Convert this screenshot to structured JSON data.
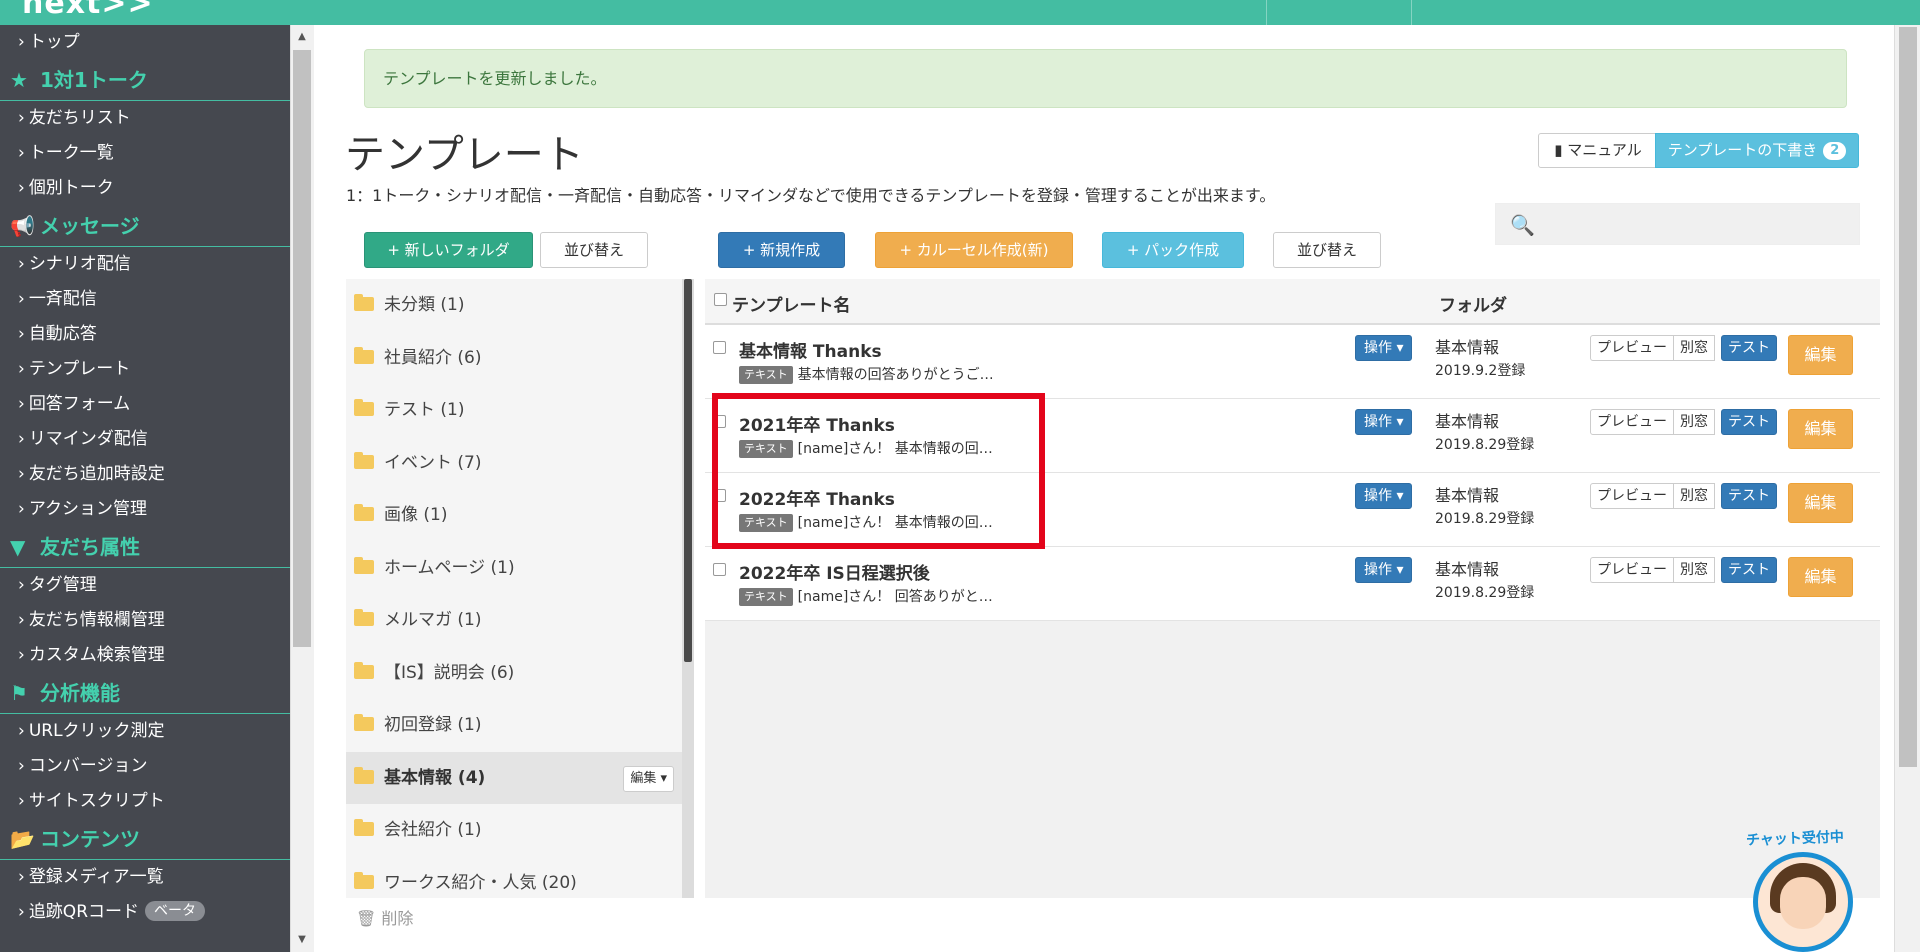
{
  "brand": {
    "logo": "next>>"
  },
  "sidebar": {
    "sections": [
      {
        "type": "item",
        "label": "トップ"
      },
      {
        "type": "section",
        "icon": "star-icon",
        "glyph": "★",
        "label": "1対1トーク"
      },
      {
        "type": "item",
        "label": "友だちリスト"
      },
      {
        "type": "item",
        "label": "トーク一覧"
      },
      {
        "type": "item",
        "label": "個別トーク"
      },
      {
        "type": "section",
        "icon": "megaphone-icon",
        "glyph": "📢",
        "label": "メッセージ"
      },
      {
        "type": "item",
        "label": "シナリオ配信"
      },
      {
        "type": "item",
        "label": "一斉配信"
      },
      {
        "type": "item",
        "label": "自動応答"
      },
      {
        "type": "item",
        "label": "テンプレート"
      },
      {
        "type": "item",
        "label": "回答フォーム"
      },
      {
        "type": "item",
        "label": "リマインダ配信"
      },
      {
        "type": "item",
        "label": "友だち追加時設定"
      },
      {
        "type": "item",
        "label": "アクション管理"
      },
      {
        "type": "section",
        "icon": "filter-icon",
        "glyph": "▼",
        "label": "友だち属性"
      },
      {
        "type": "item",
        "label": "タグ管理"
      },
      {
        "type": "item",
        "label": "友だち情報欄管理"
      },
      {
        "type": "item",
        "label": "カスタム検索管理"
      },
      {
        "type": "section",
        "icon": "flag-icon",
        "glyph": "⚑",
        "label": "分析機能"
      },
      {
        "type": "item",
        "label": "URLクリック測定"
      },
      {
        "type": "item",
        "label": "コンバージョン"
      },
      {
        "type": "item",
        "label": "サイトスクリプト"
      },
      {
        "type": "section",
        "icon": "folder-open-icon",
        "glyph": "📂",
        "label": "コンテンツ"
      },
      {
        "type": "item",
        "label": "登録メディア一覧"
      },
      {
        "type": "item",
        "label": "追跡QRコード",
        "badge": "ベータ"
      }
    ]
  },
  "alert": {
    "text": "テンプレートを更新しました。"
  },
  "page": {
    "title": "テンプレート",
    "description": "1：1トーク・シナリオ配信・一斉配信・自動応答・リマインダなどで使用できるテンプレートを登録・管理することが出来ます。",
    "manual_label": "マニュアル",
    "draft_label": "テンプレートの下書き",
    "draft_count": "2"
  },
  "toolbar": {
    "new_folder": "+ 新しいフォルダ",
    "sort_folders": "並び替え",
    "new_template": "+ 新規作成",
    "new_carousel": "+ カルーセル作成(新)",
    "new_pack": "+ パック作成",
    "sort_templates": "並び替え",
    "search_placeholder": ""
  },
  "folders": [
    {
      "label": "未分類 (1)"
    },
    {
      "label": "社員紹介 (6)"
    },
    {
      "label": "テスト (1)"
    },
    {
      "label": "イベント (7)"
    },
    {
      "label": "画像 (1)"
    },
    {
      "label": "ホームページ (1)"
    },
    {
      "label": "メルマガ (1)"
    },
    {
      "label": "【IS】説明会 (6)"
    },
    {
      "label": "初回登録 (1)"
    },
    {
      "label": "基本情報 (4)",
      "active": true,
      "edit_label": "編集 ▾"
    },
    {
      "label": "会社紹介 (1)"
    },
    {
      "label": "ワークス紹介・人気 (20)"
    }
  ],
  "delete_label": "削除",
  "table": {
    "col_name": "テンプレート名",
    "col_folder": "フォルダ",
    "rows": [
      {
        "title": "基本情報 Thanks",
        "tag": "テキスト",
        "preview": "基本情報の回答ありがとうご…",
        "folder": "基本情報",
        "date": "2019.9.2登録"
      },
      {
        "title": "2021年卒 Thanks",
        "tag": "テキスト",
        "preview": "[name]さん！ 基本情報の回…",
        "folder": "基本情報",
        "date": "2019.8.29登録"
      },
      {
        "title": "2022年卒 Thanks",
        "tag": "テキスト",
        "preview": "[name]さん！ 基本情報の回…",
        "folder": "基本情報",
        "date": "2019.8.29登録"
      },
      {
        "title": "2022年卒 IS日程選択後",
        "tag": "テキスト",
        "preview": "[name]さん！ 回答ありがと…",
        "folder": "基本情報",
        "date": "2019.8.29登録"
      }
    ],
    "op_label": "操作 ▾",
    "preview_label": "プレビュー",
    "popup_label": "別窓",
    "test_label": "テスト",
    "edit_label": "編集"
  },
  "chat": {
    "label": "チャット受付中"
  }
}
